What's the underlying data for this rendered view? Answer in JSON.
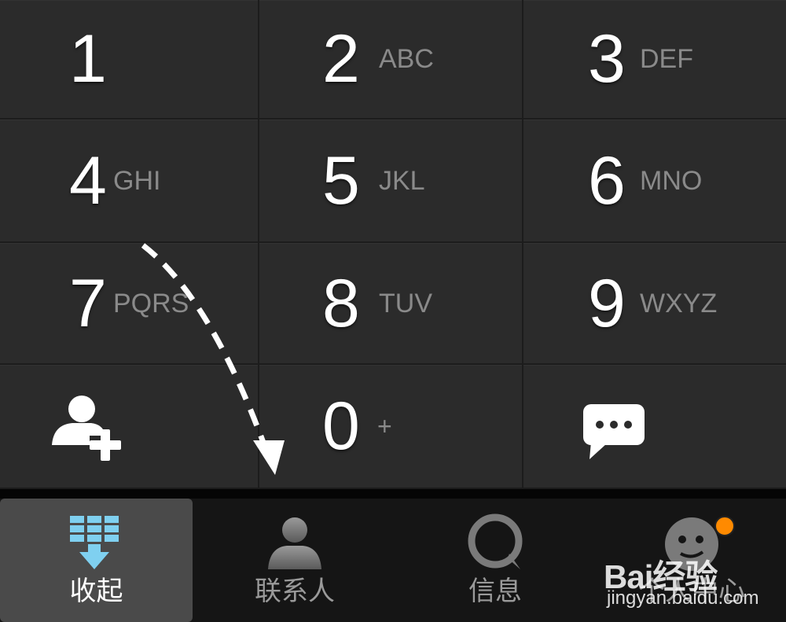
{
  "keypad": {
    "keys": [
      {
        "digit": "1",
        "letters": ""
      },
      {
        "digit": "2",
        "letters": "ABC"
      },
      {
        "digit": "3",
        "letters": "DEF"
      },
      {
        "digit": "4",
        "letters": "GHI"
      },
      {
        "digit": "5",
        "letters": "JKL"
      },
      {
        "digit": "6",
        "letters": "MNO"
      },
      {
        "digit": "7",
        "letters": "PQRS"
      },
      {
        "digit": "8",
        "letters": "TUV"
      },
      {
        "digit": "9",
        "letters": "WXYZ"
      }
    ],
    "bottom_row": {
      "add_contact_icon": "add-contact-icon",
      "zero": {
        "digit": "0",
        "letters": "+"
      },
      "message_icon": "message-icon"
    }
  },
  "tabbar": {
    "tabs": [
      {
        "label": "收起",
        "icon": "collapse-keypad-icon",
        "active": true
      },
      {
        "label": "联系人",
        "icon": "contacts-icon",
        "active": false
      },
      {
        "label": "信息",
        "icon": "messages-icon",
        "active": false
      },
      {
        "label": "个人中心",
        "icon": "profile-icon",
        "active": false
      }
    ]
  },
  "watermark": {
    "logo": "Bai经验",
    "url": "jingyan.baidu.com"
  },
  "colors": {
    "key_bg": "#2b2b2b",
    "tab_active_bg": "#4a4a4a",
    "collapse_icon_blue": "#7fd0f0",
    "notification_dot": "#ff8a00"
  }
}
